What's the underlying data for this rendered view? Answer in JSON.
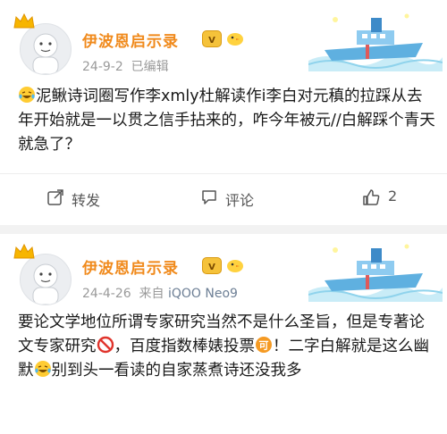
{
  "posts": [
    {
      "username": "伊波恩启示录",
      "date": "24-9-2",
      "edited": "已编辑",
      "text_parts": [
        "泥鳅诗词圈写作李xmly杜解读作i李白对元稹的拉踩从去年开始就是一以贯之信手拈来的，咋今年被元//白解踩个青天就急了？"
      ],
      "actions": {
        "repost": "转发",
        "comment": "评论",
        "like_count": "2"
      }
    },
    {
      "username": "伊波恩启示录",
      "date": "24-4-26",
      "source_prefix": "来自",
      "source": "iQOO Neo9",
      "text_parts": [
        "要论文学地位所谓专家研究当然不是什么圣旨，但是专著论文专家研究",
        "，百度指数棒婊投票",
        "！二字白解就是这么幽默",
        "别到头一看读的自家蒸煮诗还没我多"
      ]
    }
  ],
  "colors": {
    "username": "#f08a1c",
    "meta": "#9a9a9a",
    "source": "#6d7f95",
    "background": "#f2f2f2"
  },
  "icons": [
    "crown-icon",
    "vip-badge-icon",
    "chick-icon",
    "ship-decoration",
    "laugh-cry-emoji",
    "prohibited-emoji",
    "ke-badge-emoji",
    "repost-icon",
    "comment-icon",
    "like-icon"
  ]
}
